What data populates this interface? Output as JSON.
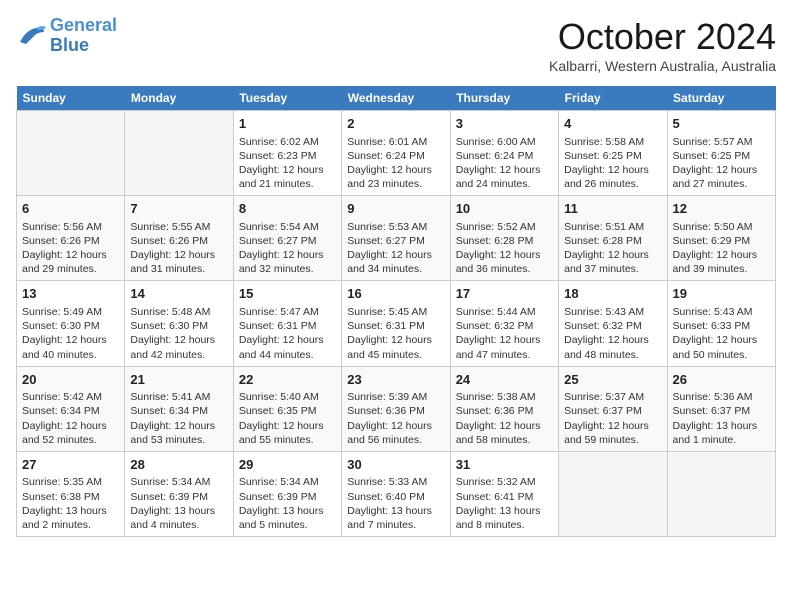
{
  "header": {
    "logo_line1": "General",
    "logo_line2": "Blue",
    "month": "October 2024",
    "location": "Kalbarri, Western Australia, Australia"
  },
  "days_of_week": [
    "Sunday",
    "Monday",
    "Tuesday",
    "Wednesday",
    "Thursday",
    "Friday",
    "Saturday"
  ],
  "weeks": [
    [
      {
        "day": "",
        "info": ""
      },
      {
        "day": "",
        "info": ""
      },
      {
        "day": "1",
        "info": "Sunrise: 6:02 AM\nSunset: 6:23 PM\nDaylight: 12 hours and 21 minutes."
      },
      {
        "day": "2",
        "info": "Sunrise: 6:01 AM\nSunset: 6:24 PM\nDaylight: 12 hours and 23 minutes."
      },
      {
        "day": "3",
        "info": "Sunrise: 6:00 AM\nSunset: 6:24 PM\nDaylight: 12 hours and 24 minutes."
      },
      {
        "day": "4",
        "info": "Sunrise: 5:58 AM\nSunset: 6:25 PM\nDaylight: 12 hours and 26 minutes."
      },
      {
        "day": "5",
        "info": "Sunrise: 5:57 AM\nSunset: 6:25 PM\nDaylight: 12 hours and 27 minutes."
      }
    ],
    [
      {
        "day": "6",
        "info": "Sunrise: 5:56 AM\nSunset: 6:26 PM\nDaylight: 12 hours and 29 minutes."
      },
      {
        "day": "7",
        "info": "Sunrise: 5:55 AM\nSunset: 6:26 PM\nDaylight: 12 hours and 31 minutes."
      },
      {
        "day": "8",
        "info": "Sunrise: 5:54 AM\nSunset: 6:27 PM\nDaylight: 12 hours and 32 minutes."
      },
      {
        "day": "9",
        "info": "Sunrise: 5:53 AM\nSunset: 6:27 PM\nDaylight: 12 hours and 34 minutes."
      },
      {
        "day": "10",
        "info": "Sunrise: 5:52 AM\nSunset: 6:28 PM\nDaylight: 12 hours and 36 minutes."
      },
      {
        "day": "11",
        "info": "Sunrise: 5:51 AM\nSunset: 6:28 PM\nDaylight: 12 hours and 37 minutes."
      },
      {
        "day": "12",
        "info": "Sunrise: 5:50 AM\nSunset: 6:29 PM\nDaylight: 12 hours and 39 minutes."
      }
    ],
    [
      {
        "day": "13",
        "info": "Sunrise: 5:49 AM\nSunset: 6:30 PM\nDaylight: 12 hours and 40 minutes."
      },
      {
        "day": "14",
        "info": "Sunrise: 5:48 AM\nSunset: 6:30 PM\nDaylight: 12 hours and 42 minutes."
      },
      {
        "day": "15",
        "info": "Sunrise: 5:47 AM\nSunset: 6:31 PM\nDaylight: 12 hours and 44 minutes."
      },
      {
        "day": "16",
        "info": "Sunrise: 5:45 AM\nSunset: 6:31 PM\nDaylight: 12 hours and 45 minutes."
      },
      {
        "day": "17",
        "info": "Sunrise: 5:44 AM\nSunset: 6:32 PM\nDaylight: 12 hours and 47 minutes."
      },
      {
        "day": "18",
        "info": "Sunrise: 5:43 AM\nSunset: 6:32 PM\nDaylight: 12 hours and 48 minutes."
      },
      {
        "day": "19",
        "info": "Sunrise: 5:43 AM\nSunset: 6:33 PM\nDaylight: 12 hours and 50 minutes."
      }
    ],
    [
      {
        "day": "20",
        "info": "Sunrise: 5:42 AM\nSunset: 6:34 PM\nDaylight: 12 hours and 52 minutes."
      },
      {
        "day": "21",
        "info": "Sunrise: 5:41 AM\nSunset: 6:34 PM\nDaylight: 12 hours and 53 minutes."
      },
      {
        "day": "22",
        "info": "Sunrise: 5:40 AM\nSunset: 6:35 PM\nDaylight: 12 hours and 55 minutes."
      },
      {
        "day": "23",
        "info": "Sunrise: 5:39 AM\nSunset: 6:36 PM\nDaylight: 12 hours and 56 minutes."
      },
      {
        "day": "24",
        "info": "Sunrise: 5:38 AM\nSunset: 6:36 PM\nDaylight: 12 hours and 58 minutes."
      },
      {
        "day": "25",
        "info": "Sunrise: 5:37 AM\nSunset: 6:37 PM\nDaylight: 12 hours and 59 minutes."
      },
      {
        "day": "26",
        "info": "Sunrise: 5:36 AM\nSunset: 6:37 PM\nDaylight: 13 hours and 1 minute."
      }
    ],
    [
      {
        "day": "27",
        "info": "Sunrise: 5:35 AM\nSunset: 6:38 PM\nDaylight: 13 hours and 2 minutes."
      },
      {
        "day": "28",
        "info": "Sunrise: 5:34 AM\nSunset: 6:39 PM\nDaylight: 13 hours and 4 minutes."
      },
      {
        "day": "29",
        "info": "Sunrise: 5:34 AM\nSunset: 6:39 PM\nDaylight: 13 hours and 5 minutes."
      },
      {
        "day": "30",
        "info": "Sunrise: 5:33 AM\nSunset: 6:40 PM\nDaylight: 13 hours and 7 minutes."
      },
      {
        "day": "31",
        "info": "Sunrise: 5:32 AM\nSunset: 6:41 PM\nDaylight: 13 hours and 8 minutes."
      },
      {
        "day": "",
        "info": ""
      },
      {
        "day": "",
        "info": ""
      }
    ]
  ]
}
